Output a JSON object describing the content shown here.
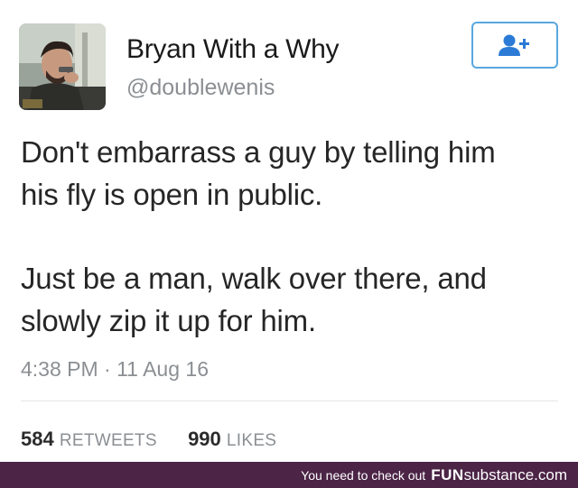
{
  "tweet": {
    "user": {
      "name": "Bryan With a Why",
      "handle": "@doublewenis"
    },
    "follow_icon": "add-user-icon",
    "text_lines": [
      "Don't embarrass a guy by telling him",
      "his fly is open in public.",
      "Just be a man, walk over there, and",
      "slowly zip it up for him."
    ],
    "timestamp": "4:38 PM · 11 Aug 16",
    "stats": {
      "retweets": "584",
      "retweets_label": "RETWEETS",
      "likes": "990",
      "likes_label": "LIKES"
    }
  },
  "footer": {
    "message": "You need to check out",
    "brand_part1": "FUN",
    "brand_part2": "substance.com"
  },
  "colors": {
    "accent": "#5aa7df",
    "footer_bg": "#4b2446",
    "muted": "#8b8f93"
  }
}
